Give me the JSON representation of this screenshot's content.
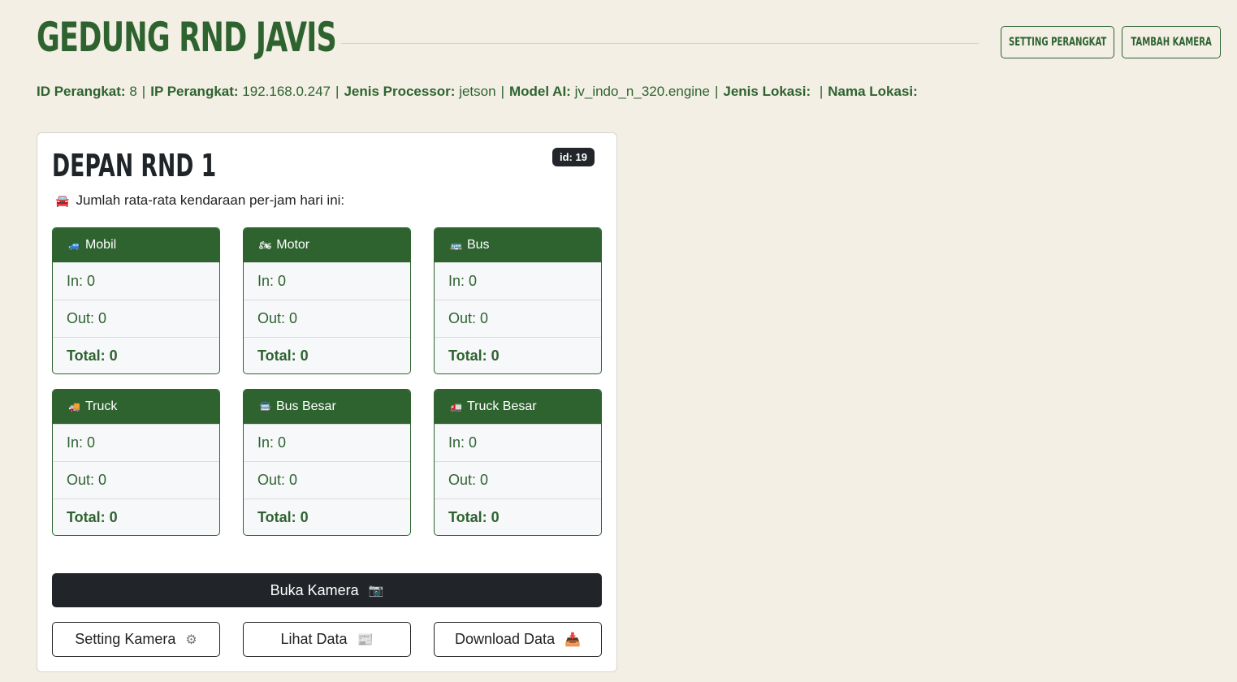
{
  "header": {
    "title": "GEDUNG RND JAVIS",
    "setting_label": "SETTING PERANGKAT",
    "add_camera_label": "TAMBAH KAMERA"
  },
  "info": {
    "id_label": "ID Perangkat:",
    "id_value": "8",
    "ip_label": "IP Perangkat:",
    "ip_value": "192.168.0.247",
    "processor_label": "Jenis Processor:",
    "processor_value": "jetson",
    "model_label": "Model AI:",
    "model_value": "jv_indo_n_320.engine",
    "location_type_label": "Jenis Lokasi:",
    "location_type_value": "",
    "location_name_label": "Nama Lokasi:",
    "location_name_value": "",
    "separator": "|"
  },
  "camera": {
    "name": "DEPAN RND 1",
    "id_badge": "id: 19",
    "subtitle": "Jumlah rata-rata kendaraan per-jam hari ini:",
    "subtitle_icon": "🚘",
    "vehicles": [
      {
        "label": "Mobil",
        "icon": "🚙",
        "in": "In: 0",
        "out": "Out: 0",
        "total": "Total: 0"
      },
      {
        "label": "Motor",
        "icon": "🏍",
        "in": "In: 0",
        "out": "Out: 0",
        "total": "Total: 0"
      },
      {
        "label": "Bus",
        "icon": "🚌",
        "in": "In: 0",
        "out": "Out: 0",
        "total": "Total: 0"
      },
      {
        "label": "Truck",
        "icon": "🚚",
        "in": "In: 0",
        "out": "Out: 0",
        "total": "Total: 0"
      },
      {
        "label": "Bus Besar",
        "icon": "🚍",
        "in": "In: 0",
        "out": "Out: 0",
        "total": "Total: 0"
      },
      {
        "label": "Truck Besar",
        "icon": "🚛",
        "in": "In: 0",
        "out": "Out: 0",
        "total": "Total: 0"
      }
    ],
    "open_camera_label": "Buka Kamera",
    "open_camera_icon": "📷",
    "setting_camera_label": "Setting Kamera",
    "setting_camera_icon": "⚙",
    "view_data_label": "Lihat Data",
    "view_data_icon": "📰",
    "download_label": "Download Data",
    "download_icon": "📥"
  }
}
